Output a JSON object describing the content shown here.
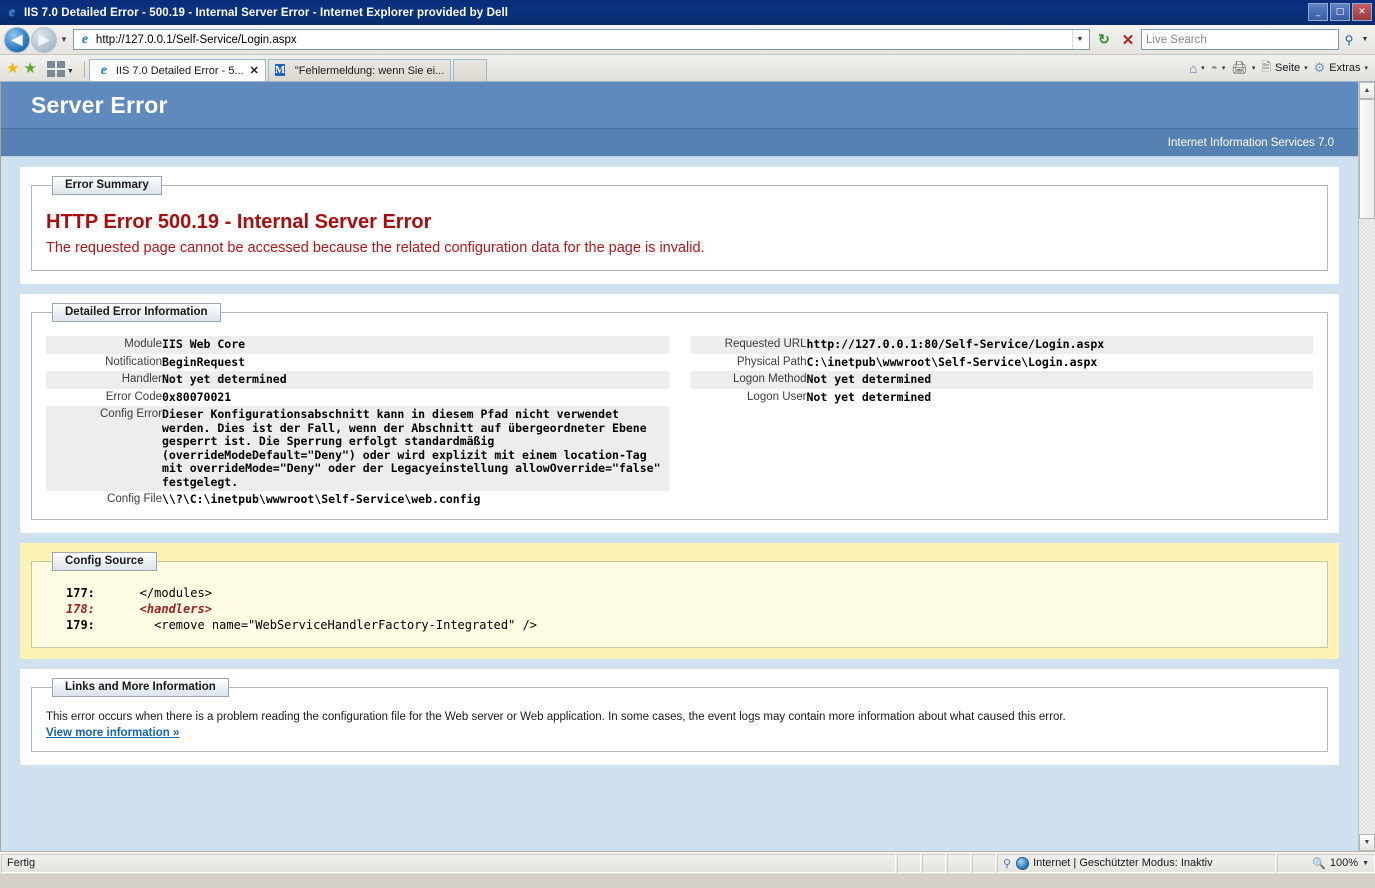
{
  "window": {
    "title": "IIS 7.0 Detailed Error - 500.19 - Internal Server Error - Internet Explorer provided by Dell",
    "icon": "ie-icon",
    "minimize_label": "_",
    "maximize_label": "□",
    "close_label": "✕"
  },
  "nav": {
    "back_label": "◀",
    "forward_label": "▶",
    "history_dropdown_label": "▼",
    "address_value": "http://127.0.0.1/Self-Service/Login.aspx",
    "address_dropdown_label": "▼",
    "refresh_label": "↻",
    "stop_label": "✕",
    "search_placeholder": "Live Search",
    "search_value": "",
    "search_go_label": "⚲",
    "search_dropdown_label": "▼"
  },
  "tabs": {
    "favorites_add_label": "★",
    "favorites_bar_label": "★",
    "quicktabs_label": "quick-tabs",
    "tablist_dropdown_label": "▼",
    "items": [
      {
        "label": "IIS 7.0 Detailed Error - 5...",
        "icon": "ie-icon",
        "active": true,
        "close_label": "✕"
      },
      {
        "label": "\"Fehlermeldung: wenn Sie ei...",
        "icon": "m-icon",
        "active": false,
        "close_label": ""
      }
    ],
    "commands": [
      {
        "name": "home",
        "label": "",
        "icon": "home-icon",
        "caret": "▾"
      },
      {
        "name": "feeds",
        "label": "",
        "icon": "rss-icon",
        "caret": "▾"
      },
      {
        "name": "print",
        "label": "",
        "icon": "print-icon",
        "caret": "▾"
      },
      {
        "name": "page",
        "label": "Seite",
        "icon": "page-icon",
        "caret": "▾"
      },
      {
        "name": "tools",
        "label": "Extras",
        "icon": "gear-icon",
        "caret": "▾"
      }
    ]
  },
  "page": {
    "header_title": "Server Error",
    "header_subtitle": "Internet Information Services 7.0",
    "header_bg_top": "#6089bd",
    "header_bg_bottom": "#5780b3",
    "body_bg": "#cfe0ef"
  },
  "error_summary": {
    "legend": "Error Summary",
    "title": "HTTP Error 500.19 - Internal Server Error",
    "description": "The requested page cannot be accessed because the related configuration data for the page is invalid.",
    "title_color": "#a90d0d",
    "description_color": "#b31616"
  },
  "detailed_error": {
    "legend": "Detailed Error Information",
    "left_rows": [
      {
        "key": "Module",
        "value": "IIS Web Core"
      },
      {
        "key": "Notification",
        "value": "BeginRequest"
      },
      {
        "key": "Handler",
        "value": "Not yet determined"
      },
      {
        "key": "Error Code",
        "value": "0x80070021"
      },
      {
        "key": "Config Error",
        "value": "Dieser Konfigurationsabschnitt kann in diesem Pfad nicht verwendet werden. Dies ist der Fall, wenn der Abschnitt auf übergeordneter Ebene gesperrt ist. Die Sperrung erfolgt standardmäßig (overrideModeDefault=\"Deny\") oder wird explizit mit einem location-Tag mit overrideMode=\"Deny\" oder der Legacyeinstellung allowOverride=\"false\" festgelegt."
      },
      {
        "key": "Config File",
        "value": "\\\\?\\C:\\inetpub\\wwwroot\\Self-Service\\web.config"
      }
    ],
    "right_rows": [
      {
        "key": "Requested URL",
        "value": "http://127.0.0.1:80/Self-Service/Login.aspx"
      },
      {
        "key": "Physical Path",
        "value": "C:\\inetpub\\wwwroot\\Self-Service\\Login.aspx"
      },
      {
        "key": "Logon Method",
        "value": "Not yet determined"
      },
      {
        "key": "Logon User",
        "value": "Not yet determined"
      }
    ]
  },
  "config_source": {
    "legend": "Config Source",
    "panel_bg": "#fcf3b4",
    "box_bg": "#fefbe3",
    "highlight_color": "#a02020",
    "lines": [
      {
        "number": "177:",
        "text": "   </modules>",
        "highlight": false
      },
      {
        "number": "178:",
        "text": "   <handlers>",
        "highlight": true
      },
      {
        "number": "179:",
        "text": "     <remove name=\"WebServiceHandlerFactory-Integrated\" />",
        "highlight": false
      }
    ]
  },
  "links": {
    "legend": "Links and More Information",
    "body": "This error occurs when there is a problem reading the configuration file for the Web server or Web application. In some cases, the event logs may contain more information about what caused this error.",
    "link_label": "View more information »",
    "link_color": "#1464b4"
  },
  "statusbar": {
    "ready_text": "Fertig",
    "zone_text": "Internet | Geschützter Modus: Inaktiv",
    "zoom_text": "100%",
    "zoom_icon": "zoom-in-icon",
    "zoom_dropdown_label": "▼"
  },
  "scrollbar": {
    "up_label": "▲",
    "down_label": "▼"
  }
}
